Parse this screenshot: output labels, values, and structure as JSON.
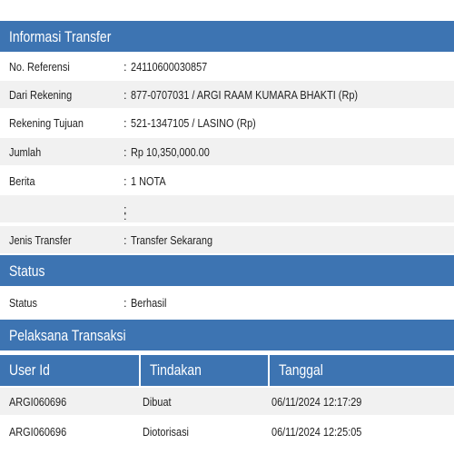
{
  "info_section": {
    "title": "Informasi Transfer",
    "rows": [
      {
        "label": "No. Referensi",
        "colon": ":",
        "value": "24110600030857"
      },
      {
        "label": "Dari Rekening",
        "colon": ":",
        "value": "877-0707031 / ARGI RAAM KUMARA BHAKTI  (Rp)"
      },
      {
        "label": "Rekening Tujuan",
        "colon": ":",
        "value": "521-1347105 / LASINO  (Rp)"
      },
      {
        "label": "Jumlah",
        "colon": ":",
        "value": "Rp  10,350,000.00"
      },
      {
        "label": "Berita",
        "colon": ":",
        "value": "1 NOTA"
      },
      {
        "label": "",
        "colon": ":",
        "value": ""
      },
      {
        "label": "",
        "colon": ":",
        "value": ""
      },
      {
        "label": "Jenis Transfer",
        "colon": ":",
        "value": "Transfer Sekarang"
      }
    ]
  },
  "status_section": {
    "title": "Status",
    "rows": [
      {
        "label": "Status",
        "colon": ":",
        "value": "Berhasil"
      }
    ]
  },
  "pelaksana_section": {
    "title": "Pelaksana Transaksi",
    "columns": [
      "User Id",
      "Tindakan",
      "Tanggal"
    ],
    "rows": [
      {
        "user_id": "ARGI060696",
        "tindakan": "Dibuat",
        "tanggal": "06/11/2024 12:17:29"
      },
      {
        "user_id": "ARGI060696",
        "tindakan": "Diotorisasi",
        "tanggal": "06/11/2024 12:25:05"
      }
    ]
  },
  "colors": {
    "header_blue": "#3d74b2",
    "row_shade": "#f1f1f1",
    "text": "#222222"
  }
}
